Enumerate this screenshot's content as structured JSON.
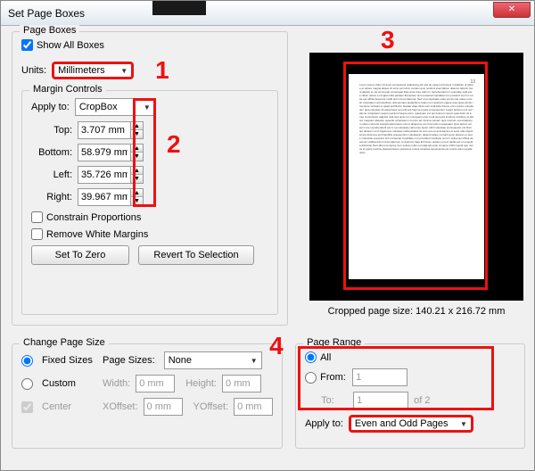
{
  "window": {
    "title": "Set Page Boxes"
  },
  "pageBoxes": {
    "group_label": "Page Boxes",
    "show_all_label": "Show All Boxes",
    "units_label": "Units:",
    "units_value": "Millimeters",
    "marginControls": {
      "group_label": "Margin Controls",
      "apply_to_label": "Apply to:",
      "apply_to_value": "CropBox",
      "top_label": "Top:",
      "top_value": "3.707 mm",
      "bottom_label": "Bottom:",
      "bottom_value": "58.979 mm",
      "left_label": "Left:",
      "left_value": "35.726 mm",
      "right_label": "Right:",
      "right_value": "39.967 mm",
      "constrain_label": "Constrain Proportions",
      "remove_white_label": "Remove White Margins",
      "set_zero_label": "Set To Zero",
      "revert_label": "Revert To Selection"
    }
  },
  "preview": {
    "caption": "Cropped page size: 140.21 x 216.72 mm"
  },
  "changePageSize": {
    "group_label": "Change Page Size",
    "fixed_label": "Fixed Sizes",
    "custom_label": "Custom",
    "center_label": "Center",
    "page_sizes_label": "Page Sizes:",
    "page_sizes_value": "None",
    "width_label": "Width:",
    "width_value": "0 mm",
    "height_label": "Height:",
    "height_value": "0 mm",
    "xoff_label": "XOffset:",
    "xoff_value": "0 mm",
    "yoff_label": "YOffset:",
    "yoff_value": "0 mm"
  },
  "pageRange": {
    "group_label": "Page Range",
    "all_label": "All",
    "from_label": "From:",
    "from_value": "1",
    "to_label": "To:",
    "to_value": "1",
    "of_label": "of 2",
    "apply_to_label": "Apply to:",
    "apply_to_value": "Even and Odd Pages"
  },
  "annotations": {
    "n1": "1",
    "n2": "2",
    "n3": "3",
    "n4": "4"
  }
}
